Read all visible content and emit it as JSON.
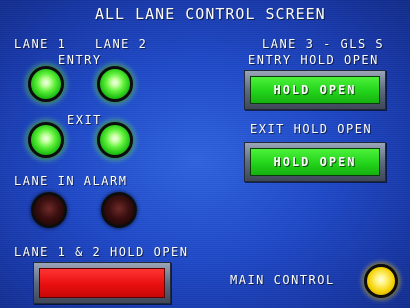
{
  "screen": {
    "title": "ALL LANE CONTROL SCREEN",
    "background_color": "#1f49c8"
  },
  "left_panel": {
    "lane1_label": "LANE 1",
    "lane2_label": "LANE 2",
    "entry_label": "ENTRY",
    "exit_label": "EXIT",
    "alarm_label": "LANE IN ALARM",
    "hold_open_label": "LANE 1 & 2 HOLD OPEN",
    "hold_open_button": {
      "label": "",
      "color": "#e80f0f"
    },
    "lamps": {
      "lane1_entry": {
        "state": "on",
        "color": "#3fe02a"
      },
      "lane2_entry": {
        "state": "on",
        "color": "#3fe02a"
      },
      "lane1_exit": {
        "state": "on",
        "color": "#3fe02a"
      },
      "lane2_exit": {
        "state": "on",
        "color": "#3fe02a"
      },
      "lane1_alarm": {
        "state": "off",
        "color": "#2a0808"
      },
      "lane2_alarm": {
        "state": "off",
        "color": "#2a0808"
      }
    }
  },
  "right_panel": {
    "lane3_label": "LANE 3 - GLS S",
    "entry_hold_open_label": "ENTRY HOLD OPEN",
    "entry_hold_open_button": {
      "label": "HOLD OPEN",
      "color": "#22d41a"
    },
    "exit_hold_open_label": "EXIT HOLD OPEN",
    "exit_hold_open_button": {
      "label": "HOLD OPEN",
      "color": "#22d41a"
    }
  },
  "main_control": {
    "label": "MAIN CONTROL",
    "lamp_color": "#f4d000"
  }
}
